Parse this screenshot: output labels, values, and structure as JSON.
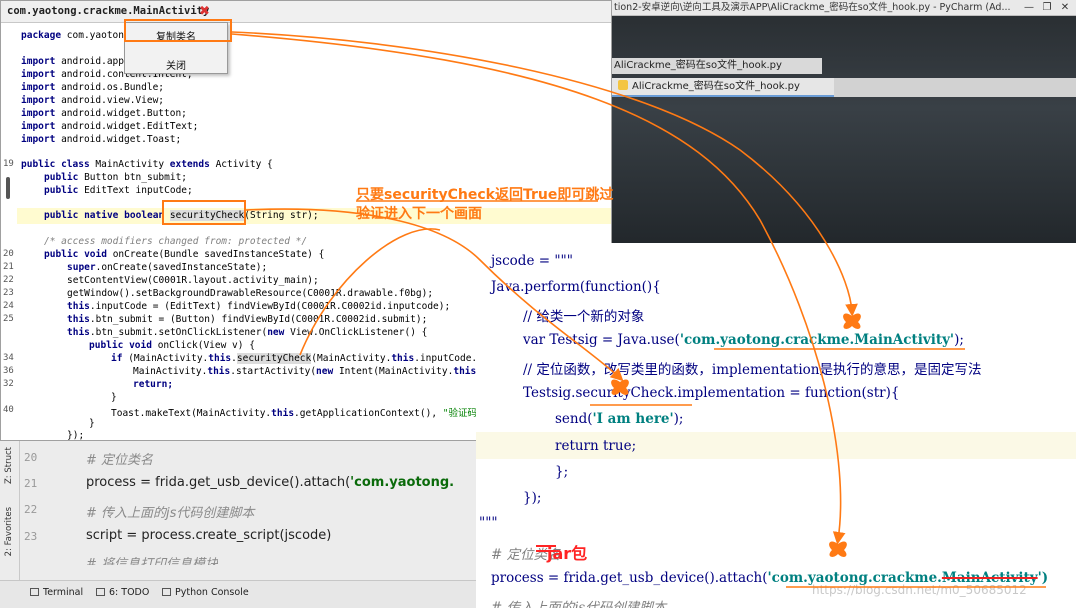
{
  "window_title": "tion2-安卓逆向\\逆向工具及演示APP\\AliCrackme_密码在so文件_hook.py - PyCharm (Ad...",
  "window_buttons": [
    "—",
    "❐",
    "✕"
  ],
  "editor_tabs": {
    "tab_a": "AliCrackme_密码在so文件_hook.py",
    "tab_b": "AliCrackme_密码在so文件_hook.py"
  },
  "jadx": {
    "tab_title": "com.yaotong.crackme.MainActivity",
    "tab_close": "✖",
    "context_menu": {
      "copy_class_name": "复制类名",
      "close": "关闭"
    },
    "line_numbers": [
      "19",
      "20",
      "21",
      "22",
      "23",
      "24",
      "25",
      "34",
      "36",
      "32",
      "40"
    ],
    "lines": {
      "l01": "com.yaotong.",
      "l02": "android.app.A",
      "l03": "android.content.Intent;",
      "l04": "android.os.Bundle;",
      "l05": "android.view.View;",
      "l06": "android.widget.Button;",
      "l07": "android.widget.EditText;",
      "l08": "android.widget.Toast;",
      "l09": "MainActivity",
      "l09b": "Activity {",
      "l10": "Button btn_submit;",
      "l11": "EditText inputCode;",
      "l12": "securityCheck",
      "l12b": "(String str);",
      "l13": "/* access modifiers changed from: protected */",
      "l14": "onCreate(Bundle savedInstanceState) {",
      "l15": ".onCreate(savedInstanceState);",
      "l16": "setContentView(C0001R.layout.activity_main);",
      "l17": "getWindow().setBackgroundDrawableResource(C0001R.drawable.f0bg);",
      "l18": ".inputCode = (EditText) findViewById(C0001R.C0002id.inputcode);",
      "l19": ".btn_submit = (Button) findViewById(C0001R.C0002id.submit);",
      "l20": ".btn_submit.setOnClickListener(",
      "l20b": "View.OnClickListener() {",
      "l21": "onClick(View v) {",
      "l22": "(MainActivity.",
      "l22b": "securityCheck",
      "l22c": "(MainActivity.",
      "l22d": ".inputCode.ge",
      "l23": "MainActivity.",
      "l23b": ".startActivity(",
      "l23c": "Intent(MainActivity.",
      "l23d": ",",
      "l24": "Toast.makeText(MainActivity.",
      "l24b": ".getApplicationContext(),",
      "l24c": "\"验证码错",
      "kw_package": "package",
      "kw_import": "import",
      "kw_public": "public",
      "kw_class": "class",
      "kw_extends": "extends",
      "kw_native": "native",
      "kw_boolean": "boolean",
      "kw_void": "void",
      "kw_super": "super",
      "kw_this": "this",
      "kw_new": "new",
      "kw_if": "if",
      "kw_return": "return;",
      "close1": "}",
      "close2": "});",
      "close3": "}",
      "close4": "});"
    }
  },
  "side_strip": {
    "structure": "Z: Struct",
    "favorites": "2: Favorites"
  },
  "background_code": {
    "line_numbers": [
      "20",
      "21",
      "22",
      "23"
    ],
    "lines": [
      "# 定位类名",
      "process = frida.get_usb_device().attach(",
      "'com.yaotong.",
      "# 传入上面的js代码创建脚本",
      "script = process.create_script(jscode)",
      "# 将信息打印信息模块"
    ]
  },
  "bottom_bar": {
    "terminal": "Terminal",
    "todo": "6: TODO",
    "python_console": "Python Console"
  },
  "python_panel": {
    "l1": "jscode = \"\"\"",
    "l2": "Java.perform(function(){",
    "l3": "// 给类一个新的对象",
    "l4": "var Testsig = Java.use(",
    "l4s": "'com.yaotong.crackme.MainActivity'",
    "l4e": ");",
    "l5": "// 定位函数，改写类里的函数，implementation是执行的意思，是固定写法",
    "l6": "Testsig.securityCheck.implementation = function(str){",
    "l7": "send(",
    "l7s": "'I am here'",
    "l7e": ");",
    "l8": "return true;",
    "l9": "};",
    "l10": "});",
    "l11": "\"\"\"",
    "l12": "# 定位类名",
    "l13": "process = frida.get_usb_device().attach(",
    "l13s": "'com.yaotong.crackme.",
    "l13x": "MainActivity",
    "l13e": "')",
    "l14": "# 传入上面的js代码创建脚本"
  },
  "annotations": {
    "note_line1": "只要securityCheck返回True即可跳过",
    "note_line2": "验证进入下一个画面",
    "jar": "jar包"
  },
  "watermark": "https://blog.csdn.net/m0_50685012",
  "colors": {
    "annotation": "#ff7a14",
    "jar_note": "#ff2424",
    "keyword": "#000080",
    "string": "#008080"
  }
}
